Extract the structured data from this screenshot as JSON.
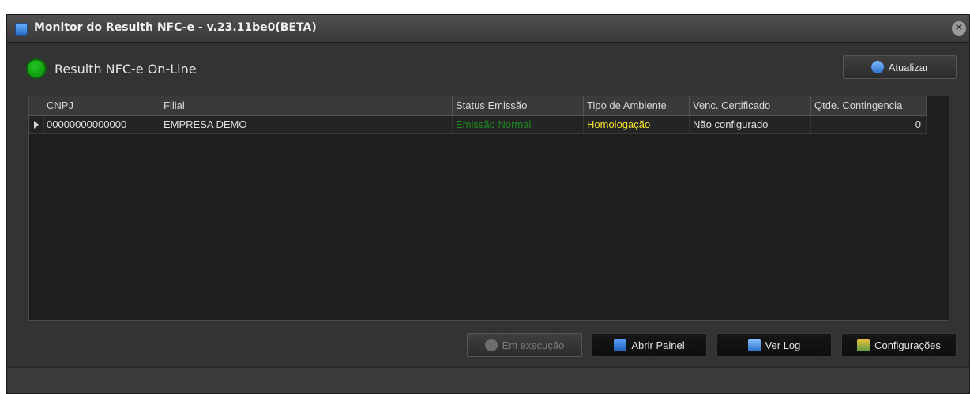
{
  "window": {
    "title": "Monitor do Resulth NFC-e - v.23.11be0(BETA)",
    "close_glyph": "✕"
  },
  "status": {
    "text": "Resulth NFC-e On-Line",
    "color": "#18b018"
  },
  "buttons": {
    "refresh": {
      "label": "Atualizar",
      "icon": "refresh-icon"
    },
    "running": {
      "label": "Em execução",
      "icon": "play-icon"
    },
    "open_panel": {
      "label": "Abrir Painel",
      "icon": "panel-icon"
    },
    "view_log": {
      "label": "Ver Log",
      "icon": "magnifier-icon"
    },
    "settings": {
      "label": "Configurações",
      "icon": "settings-icon"
    }
  },
  "grid": {
    "columns": [
      "CNPJ",
      "Filial",
      "Status Emissão",
      "Tipo de Ambiente",
      "Venc. Certificado",
      "Qtde. Contingencia"
    ],
    "rows": [
      {
        "cnpj": "00000000000000",
        "filial": "EMPRESA DEMO",
        "status_emissao": "Emissão Normal",
        "tipo_ambiente": "Homologação",
        "venc_certificado": "Não configurado",
        "qtde_contingencia": "0"
      }
    ]
  },
  "colors": {
    "status_emissao": "#1e8a1e",
    "tipo_ambiente": "#f2e52a"
  }
}
